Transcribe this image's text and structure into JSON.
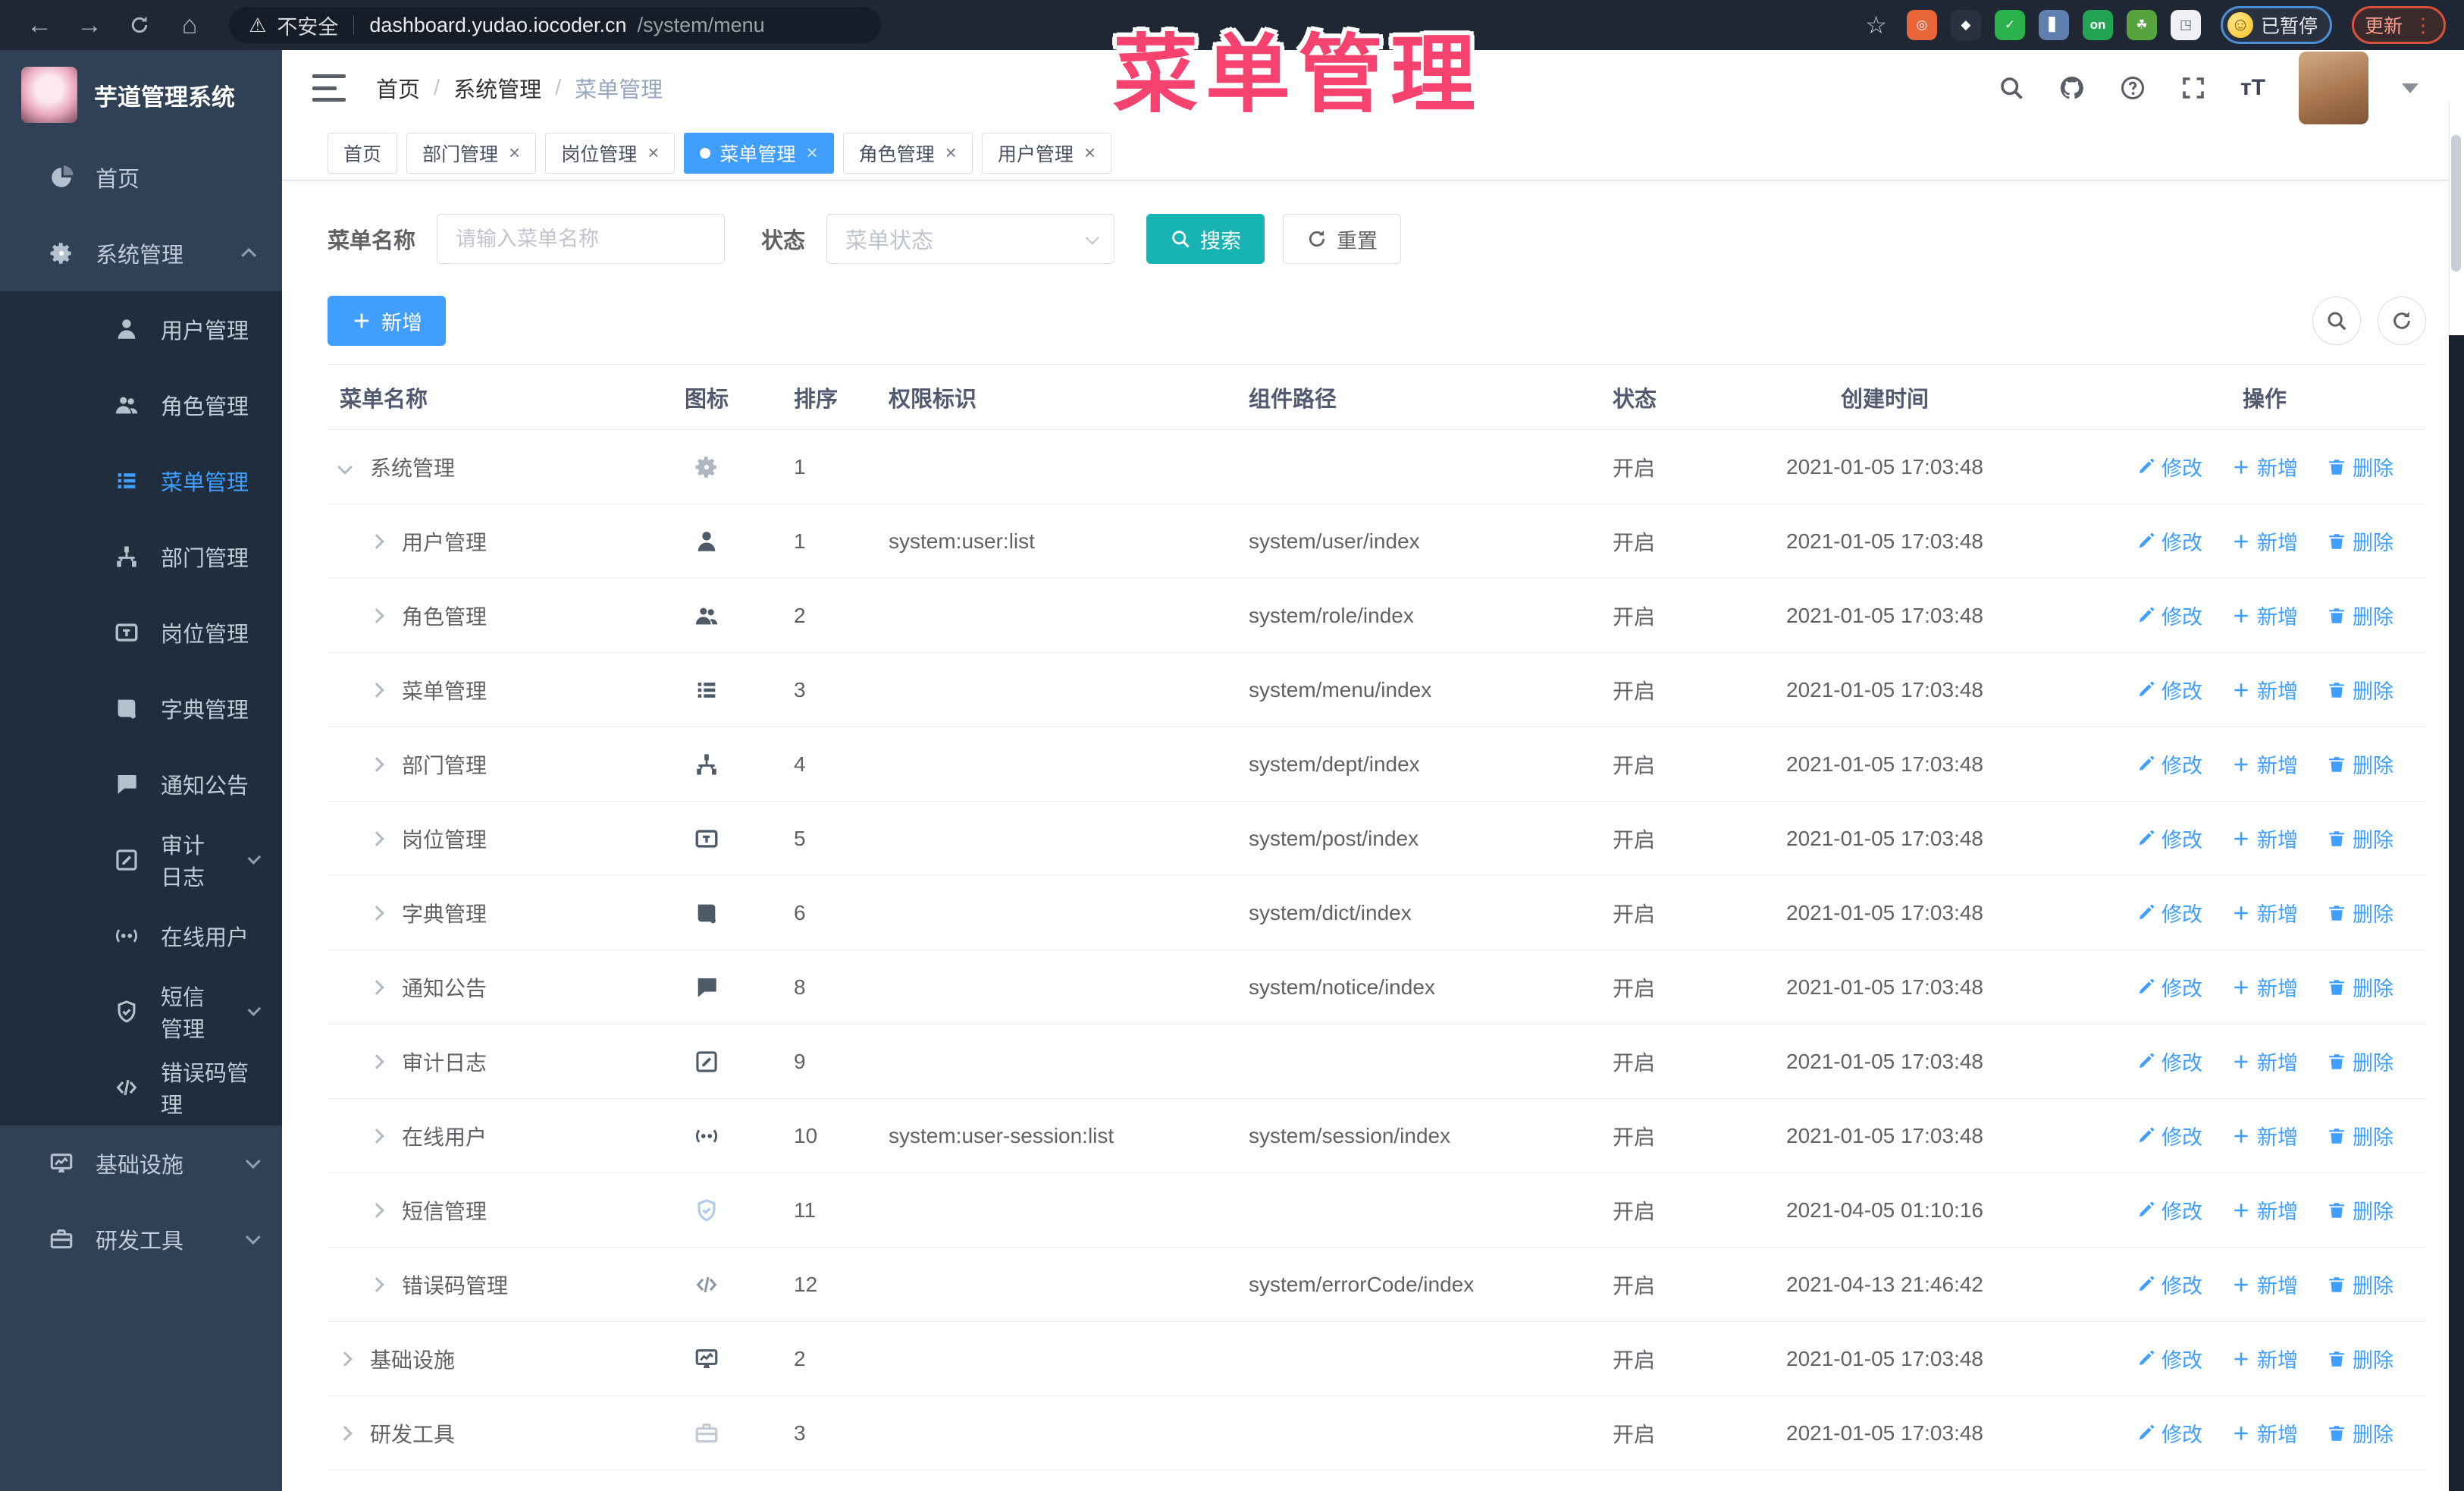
{
  "browser": {
    "security_label": "不安全",
    "url_host": "dashboard.yudao.iocoder.cn",
    "url_path": "/system/menu",
    "paused_badge": "已暂停",
    "paused_face": "☺",
    "update_label": "更新",
    "extensions": [
      {
        "name": "ext-orange",
        "bg": "#e8653a",
        "glyph": "◎"
      },
      {
        "name": "ext-gem",
        "bg": "#2a3140",
        "glyph": "◆"
      },
      {
        "name": "ext-shield-green",
        "bg": "#2bb24c",
        "glyph": "✓"
      },
      {
        "name": "ext-columns",
        "bg": "#5f7fae",
        "glyph": "▋"
      },
      {
        "name": "ext-on",
        "bg": "#23a455",
        "glyph": "on"
      },
      {
        "name": "ext-green",
        "bg": "#57a33e",
        "glyph": "☘"
      },
      {
        "name": "ext-puzzle",
        "bg": "#eef0f3",
        "glyph": "◳",
        "fg": "#5a6270"
      }
    ]
  },
  "annotation": {
    "text": "菜单管理",
    "color": "#f5426e"
  },
  "sidebar": {
    "logo_title": "芋道管理系统",
    "items": [
      {
        "label": "首页",
        "icon": "home",
        "is_sub": false,
        "active": false,
        "has_arrow": false,
        "arrow_up": false
      },
      {
        "label": "系统管理",
        "icon": "gear",
        "is_sub": false,
        "active": false,
        "has_arrow": true,
        "arrow_up": true
      },
      {
        "label": "用户管理",
        "icon": "user",
        "is_sub": true,
        "active": false,
        "has_arrow": false,
        "arrow_up": false
      },
      {
        "label": "角色管理",
        "icon": "users",
        "is_sub": true,
        "active": false,
        "has_arrow": false,
        "arrow_up": false
      },
      {
        "label": "菜单管理",
        "icon": "menu",
        "is_sub": true,
        "active": true,
        "has_arrow": false,
        "arrow_up": false
      },
      {
        "label": "部门管理",
        "icon": "tree",
        "is_sub": true,
        "active": false,
        "has_arrow": false,
        "arrow_up": false
      },
      {
        "label": "岗位管理",
        "icon": "badge",
        "is_sub": true,
        "active": false,
        "has_arrow": false,
        "arrow_up": false
      },
      {
        "label": "字典管理",
        "icon": "book",
        "is_sub": true,
        "active": false,
        "has_arrow": false,
        "arrow_up": false
      },
      {
        "label": "通知公告",
        "icon": "message",
        "is_sub": true,
        "active": false,
        "has_arrow": false,
        "arrow_up": false
      },
      {
        "label": "审计日志",
        "icon": "log",
        "is_sub": true,
        "active": false,
        "has_arrow": true,
        "arrow_up": false
      },
      {
        "label": "在线用户",
        "icon": "online",
        "is_sub": true,
        "active": false,
        "has_arrow": false,
        "arrow_up": false
      },
      {
        "label": "短信管理",
        "icon": "shield",
        "is_sub": true,
        "active": false,
        "has_arrow": true,
        "arrow_up": false
      },
      {
        "label": "错误码管理",
        "icon": "code",
        "is_sub": true,
        "active": false,
        "has_arrow": false,
        "arrow_up": false
      },
      {
        "label": "基础设施",
        "icon": "monitor",
        "is_sub": false,
        "active": false,
        "has_arrow": true,
        "arrow_up": false
      },
      {
        "label": "研发工具",
        "icon": "tool",
        "is_sub": false,
        "active": false,
        "has_arrow": true,
        "arrow_up": false
      }
    ]
  },
  "header": {
    "breadcrumb": [
      "首页",
      "系统管理",
      "菜单管理"
    ],
    "separator": "/"
  },
  "tabs": [
    {
      "label": "首页",
      "closable": false,
      "active": false
    },
    {
      "label": "部门管理",
      "closable": true,
      "active": false
    },
    {
      "label": "岗位管理",
      "closable": true,
      "active": false
    },
    {
      "label": "菜单管理",
      "closable": true,
      "active": true
    },
    {
      "label": "角色管理",
      "closable": true,
      "active": false
    },
    {
      "label": "用户管理",
      "closable": true,
      "active": false
    }
  ],
  "filters": {
    "name_label": "菜单名称",
    "name_placeholder": "请输入菜单名称",
    "status_label": "状态",
    "status_placeholder": "菜单状态",
    "search_label": "搜索",
    "reset_label": "重置"
  },
  "toolbar": {
    "add_label": "新增"
  },
  "table": {
    "columns": [
      "菜单名称",
      "图标",
      "排序",
      "权限标识",
      "组件路径",
      "状态",
      "创建时间",
      "操作"
    ],
    "actions": {
      "edit": "修改",
      "add": "新增",
      "delete": "删除"
    },
    "rows": [
      {
        "name": "系统管理",
        "icon": "gear",
        "icon_color": "#aeb6c0",
        "is_sub": false,
        "expanded": true,
        "sort": "1",
        "perm": "",
        "path": "",
        "status": "开启",
        "time": "2021-01-05 17:03:48"
      },
      {
        "name": "用户管理",
        "icon": "user",
        "icon_color": "#4e5a68",
        "is_sub": true,
        "expanded": false,
        "sort": "1",
        "perm": "system:user:list",
        "path": "system/user/index",
        "status": "开启",
        "time": "2021-01-05 17:03:48"
      },
      {
        "name": "角色管理",
        "icon": "users",
        "icon_color": "#4e5a68",
        "is_sub": true,
        "expanded": false,
        "sort": "2",
        "perm": "",
        "path": "system/role/index",
        "status": "开启",
        "time": "2021-01-05 17:03:48"
      },
      {
        "name": "菜单管理",
        "icon": "menu",
        "icon_color": "#4e5a68",
        "is_sub": true,
        "expanded": false,
        "sort": "3",
        "perm": "",
        "path": "system/menu/index",
        "status": "开启",
        "time": "2021-01-05 17:03:48"
      },
      {
        "name": "部门管理",
        "icon": "tree",
        "icon_color": "#4e5a68",
        "is_sub": true,
        "expanded": false,
        "sort": "4",
        "perm": "",
        "path": "system/dept/index",
        "status": "开启",
        "time": "2021-01-05 17:03:48"
      },
      {
        "name": "岗位管理",
        "icon": "badge",
        "icon_color": "#4e5a68",
        "is_sub": true,
        "expanded": false,
        "sort": "5",
        "perm": "",
        "path": "system/post/index",
        "status": "开启",
        "time": "2021-01-05 17:03:48"
      },
      {
        "name": "字典管理",
        "icon": "book",
        "icon_color": "#4e5a68",
        "is_sub": true,
        "expanded": false,
        "sort": "6",
        "perm": "",
        "path": "system/dict/index",
        "status": "开启",
        "time": "2021-01-05 17:03:48"
      },
      {
        "name": "通知公告",
        "icon": "message",
        "icon_color": "#4e5a68",
        "is_sub": true,
        "expanded": false,
        "sort": "8",
        "perm": "",
        "path": "system/notice/index",
        "status": "开启",
        "time": "2021-01-05 17:03:48"
      },
      {
        "name": "审计日志",
        "icon": "log",
        "icon_color": "#4e5a68",
        "is_sub": true,
        "expanded": false,
        "sort": "9",
        "perm": "",
        "path": "",
        "status": "开启",
        "time": "2021-01-05 17:03:48"
      },
      {
        "name": "在线用户",
        "icon": "online",
        "icon_color": "#4e5a68",
        "is_sub": true,
        "expanded": false,
        "sort": "10",
        "perm": "system:user-session:list",
        "path": "system/session/index",
        "status": "开启",
        "time": "2021-01-05 17:03:48"
      },
      {
        "name": "短信管理",
        "icon": "shield",
        "icon_color": "#aecbe8",
        "is_sub": true,
        "expanded": false,
        "sort": "11",
        "perm": "",
        "path": "",
        "status": "开启",
        "time": "2021-04-05 01:10:16"
      },
      {
        "name": "错误码管理",
        "icon": "code",
        "icon_color": "#8d97a5",
        "is_sub": true,
        "expanded": false,
        "sort": "12",
        "perm": "",
        "path": "system/errorCode/index",
        "status": "开启",
        "time": "2021-04-13 21:46:42"
      },
      {
        "name": "基础设施",
        "icon": "monitor",
        "icon_color": "#4e5a68",
        "is_sub": false,
        "expanded": false,
        "sort": "2",
        "perm": "",
        "path": "",
        "status": "开启",
        "time": "2021-01-05 17:03:48"
      },
      {
        "name": "研发工具",
        "icon": "tool",
        "icon_color": "#c3c9d2",
        "is_sub": false,
        "expanded": false,
        "sort": "3",
        "perm": "",
        "path": "",
        "status": "开启",
        "time": "2021-01-05 17:03:48"
      }
    ]
  },
  "colors": {
    "accent": "#409eff",
    "search_teal": "#18b3b3",
    "sidebar_bg": "#304156",
    "submenu_bg": "#1f2d3d",
    "annotation_pink": "#f5426e"
  }
}
